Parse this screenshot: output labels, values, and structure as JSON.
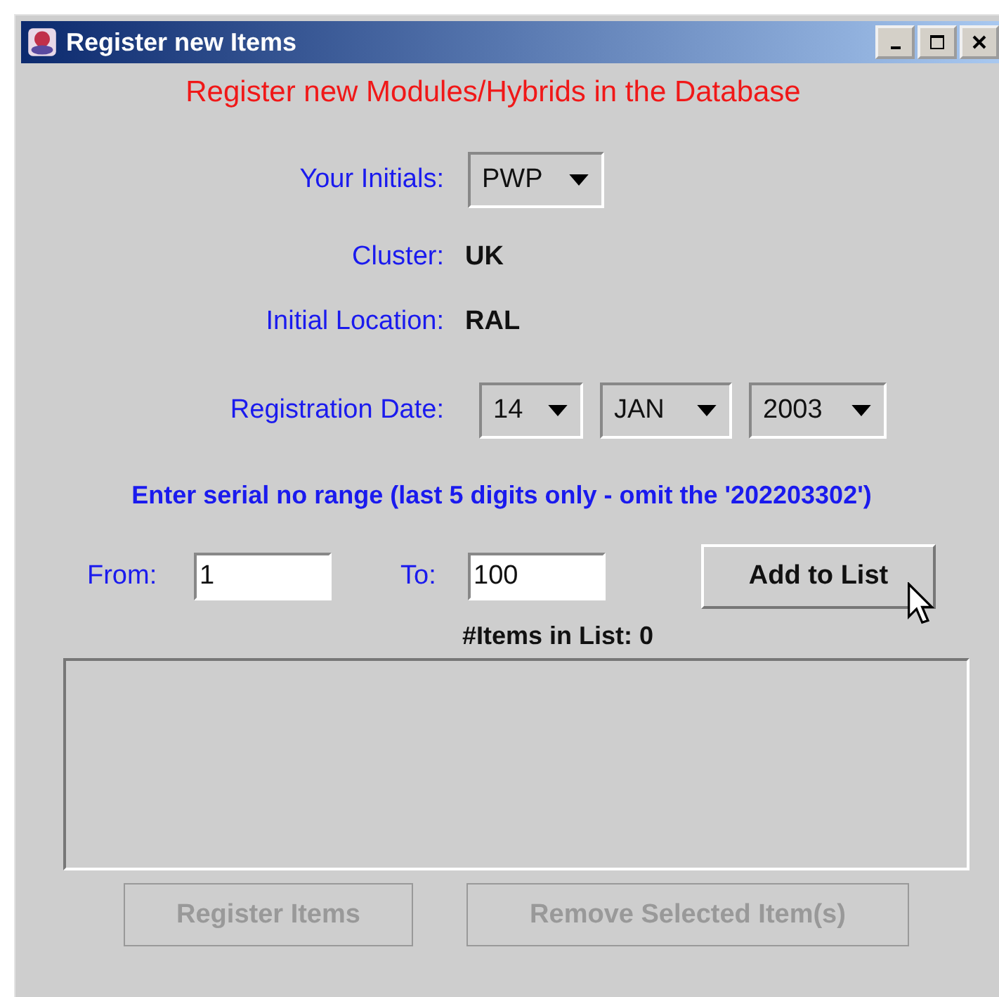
{
  "window": {
    "title": "Register new Items"
  },
  "heading": "Register new Modules/Hybrids in the Database",
  "initials": {
    "label": "Your Initials:",
    "value": "PWP"
  },
  "cluster": {
    "label": "Cluster:",
    "value": "UK"
  },
  "location": {
    "label": "Initial Location:",
    "value": "RAL"
  },
  "date": {
    "label": "Registration Date:",
    "day": "14",
    "month": "JAN",
    "year": "2003"
  },
  "instruction": "Enter serial no range (last 5 digits only - omit the '202203302')",
  "range": {
    "from_label": "From:",
    "from_value": "1",
    "to_label": "To:",
    "to_value": "100"
  },
  "add_button": {
    "label": "Add to List",
    "disabled": false
  },
  "items_count": "#Items in List: 0",
  "buttons": [
    {
      "label": "Register Items",
      "disabled": true
    },
    {
      "label": "Remove Selected Item(s)",
      "disabled": true
    }
  ]
}
